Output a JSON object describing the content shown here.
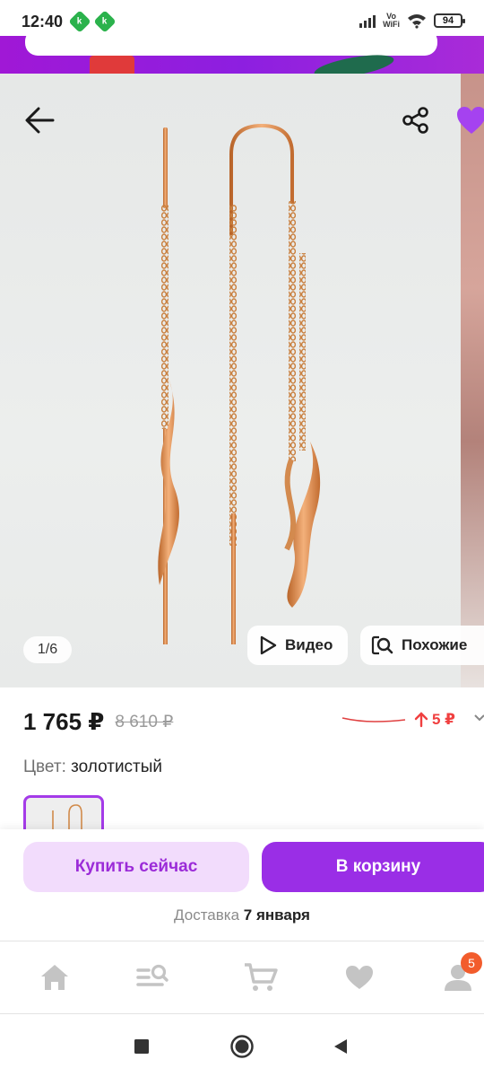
{
  "status_bar": {
    "time": "12:40",
    "notification_badges": [
      "k",
      "k"
    ],
    "vowifi_top": "Vo",
    "vowifi_bottom": "WiFi",
    "battery": "94"
  },
  "gallery": {
    "counter": "1/6",
    "video_label": "Видео",
    "similar_label": "Похожие",
    "icons": [
      "arrow-left-icon",
      "share-icon",
      "heart-icon",
      "play-icon",
      "image-search-icon"
    ]
  },
  "product": {
    "price": "1 765 ₽",
    "old_price": "8 610 ₽",
    "price_change": "5 ₽",
    "color_label": "Цвет:",
    "color_value": "золотистый"
  },
  "actions": {
    "buy_now": "Купить сейчас",
    "add_to_cart": "В корзину",
    "delivery_label": "Доставка",
    "delivery_date": "7 января"
  },
  "bottom_nav": {
    "items": [
      "home-icon",
      "catalog-search-icon",
      "cart-icon",
      "favorites-icon",
      "profile-icon"
    ],
    "profile_badge": "5"
  },
  "colors": {
    "accent": "#9a2ee6",
    "accent_light": "#f2dcfc",
    "price_up": "#f04040",
    "badge": "#f25c2c"
  }
}
